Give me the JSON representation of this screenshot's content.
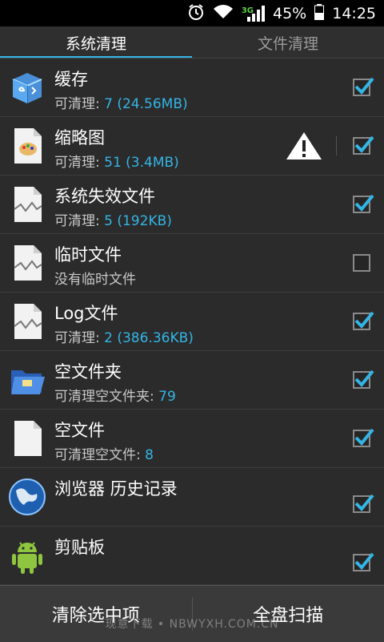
{
  "status_bar": {
    "network": "3G",
    "battery": "45%",
    "time": "14:25",
    "icons": [
      "alarm-icon",
      "wifi-icon",
      "signal-icon",
      "battery-icon"
    ]
  },
  "tabs": [
    {
      "label": "系统清理",
      "active": true
    },
    {
      "label": "文件清理",
      "active": false
    }
  ],
  "accent_color": "#33b5e5",
  "items": [
    {
      "title": "缓存",
      "sub_prefix": "可清理: ",
      "sub_value": "7 (24.56MB)",
      "checked": true,
      "icon": "cache-box-icon"
    },
    {
      "title": "缩略图",
      "sub_prefix": "可清理: ",
      "sub_value": "51 (3.4MB)",
      "checked": true,
      "icon": "image-file-icon",
      "warning": true
    },
    {
      "title": "系统失效文件",
      "sub_prefix": "可清理: ",
      "sub_value": "5 (192KB)",
      "checked": true,
      "icon": "broken-file-icon"
    },
    {
      "title": "临时文件",
      "sub_prefix": "没有临时文件",
      "sub_value": "",
      "checked": false,
      "icon": "broken-file-icon"
    },
    {
      "title": "Log文件",
      "sub_prefix": "可清理: ",
      "sub_value": "2 (386.36KB)",
      "checked": true,
      "icon": "broken-file-icon"
    },
    {
      "title": "空文件夹",
      "sub_prefix": "可清理空文件夹: ",
      "sub_value": "79",
      "checked": true,
      "icon": "folder-icon"
    },
    {
      "title": "空文件",
      "sub_prefix": "可清理空文件: ",
      "sub_value": "8",
      "checked": true,
      "icon": "blank-file-icon"
    },
    {
      "title": "浏览器 历史记录",
      "sub_prefix": "",
      "sub_value": "",
      "checked": true,
      "icon": "globe-icon"
    },
    {
      "title": "剪贴板",
      "sub_prefix": "",
      "sub_value": "",
      "checked": true,
      "icon": "android-icon"
    }
  ],
  "bottom": {
    "clear_label": "清除选中项",
    "scan_label": "全盘扫描"
  },
  "watermark": "现意下载 • NBWYXH.COM.CN"
}
